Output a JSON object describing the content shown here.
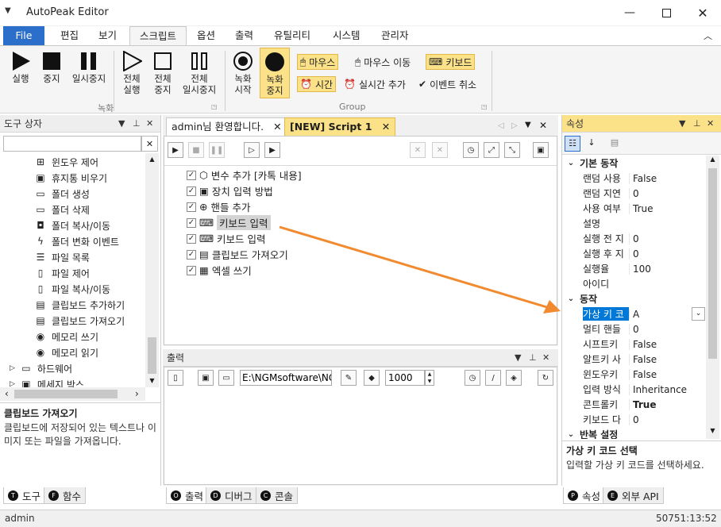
{
  "window": {
    "title": "AutoPeak Editor"
  },
  "ribbon_tabs": [
    "File",
    "편집",
    "보기",
    "스크립트",
    "옵션",
    "출력",
    "유틸리티",
    "시스템",
    "관리자"
  ],
  "ribbon": {
    "record_group": {
      "label": "녹화",
      "buttons": [
        {
          "line1": "실행",
          "line2": ""
        },
        {
          "line1": "중지",
          "line2": ""
        },
        {
          "line1": "일시중지",
          "line2": ""
        },
        {
          "line1": "전체",
          "line2": "실행"
        },
        {
          "line1": "전체",
          "line2": "중지"
        },
        {
          "line1": "전체",
          "line2": "일시중지"
        }
      ]
    },
    "group2": {
      "label": "Group",
      "record_start": {
        "line1": "녹화",
        "line2": "시작"
      },
      "record_stop": {
        "line1": "녹화",
        "line2": "중지"
      },
      "mouse": "마우스",
      "mouse_move": "마우스 이동",
      "keyboard": "키보드",
      "time": "시간",
      "realtime_add": "실시간 추가",
      "event_cancel": "이벤트 취소"
    }
  },
  "toolbox": {
    "title": "도구 상자",
    "search_placeholder": "",
    "items": [
      {
        "label": "윈도우 제어",
        "icon": "windows-icon"
      },
      {
        "label": "휴지통 비우기",
        "icon": "trash-icon"
      },
      {
        "label": "폴더 생성",
        "icon": "folder-icon"
      },
      {
        "label": "폴더 삭제",
        "icon": "folder-icon"
      },
      {
        "label": "폴더 복사/이동",
        "icon": "folder-copy-icon"
      },
      {
        "label": "폴더 변화 이벤트",
        "icon": "lightning-icon"
      },
      {
        "label": "파일 목록",
        "icon": "list-icon"
      },
      {
        "label": "파일 제어",
        "icon": "file-icon"
      },
      {
        "label": "파일 복사/이동",
        "icon": "file-copy-icon"
      },
      {
        "label": "클립보드 추가하기",
        "icon": "clipboard-icon"
      },
      {
        "label": "클립보드 가져오기",
        "icon": "clipboard-icon"
      },
      {
        "label": "메모리 쓰기",
        "icon": "memory-icon"
      },
      {
        "label": "메모리 읽기",
        "icon": "memory-icon"
      }
    ],
    "roots": [
      {
        "label": "하드웨어"
      },
      {
        "label": "메세지 박스"
      }
    ],
    "desc_title": "클립보드 가져오기",
    "desc_text": "클립보드에 저장되어 있는 텍스트나 이미지 또는 파일을 가져옵니다.",
    "tabs": [
      {
        "letter": "T",
        "label": "도구"
      },
      {
        "letter": "F",
        "label": "함수"
      }
    ]
  },
  "document": {
    "tabs": [
      {
        "label": "admin님 환영합니다."
      },
      {
        "label": "[NEW] Script 1"
      }
    ],
    "script_lines": [
      "변수 추가 [카톡 내용]",
      "장치 입력 방법",
      "핸들 추가",
      "키보드 입력",
      "키보드 입력",
      "클립보드 가져오기",
      "엑셀 쓰기"
    ]
  },
  "output": {
    "title": "출력",
    "path_value": "E:\\NGMsoftware\\NG",
    "count_value": "1000",
    "tabs": [
      {
        "letter": "O",
        "label": "출력"
      },
      {
        "letter": "D",
        "label": "디버그"
      },
      {
        "letter": "C",
        "label": "콘솔"
      }
    ]
  },
  "properties": {
    "title": "속성",
    "cat_basic": "기본 동작",
    "basic_rows": [
      {
        "key": "랜덤 사용",
        "value": "False"
      },
      {
        "key": "랜덤 지연",
        "value": "0"
      },
      {
        "key": "사용 여부",
        "value": "True"
      },
      {
        "key": "설명",
        "value": ""
      },
      {
        "key": "실행 전 지",
        "value": "0"
      },
      {
        "key": "실행 후 지",
        "value": "0"
      },
      {
        "key": "실행율",
        "value": "100"
      },
      {
        "key": "아이디",
        "value": ""
      }
    ],
    "cat_action": "동작",
    "action_rows": [
      {
        "key": "가상 키 코",
        "value": "A"
      },
      {
        "key": "멀티 핸들",
        "value": "0"
      },
      {
        "key": "시프트키 ",
        "value": "False"
      },
      {
        "key": "알트키 사",
        "value": "False"
      },
      {
        "key": "윈도우키 ",
        "value": "False"
      },
      {
        "key": "입력 방식",
        "value": "Inheritance"
      },
      {
        "key": "콘트롤키 ",
        "value": "True"
      },
      {
        "key": "키보드 다",
        "value": "0"
      }
    ],
    "cat_repeat": "반복 설정",
    "desc_title": "가상 키 코드 선택",
    "desc_text": "입력할 가상 키 코드를 선택하세요.",
    "tabs": [
      {
        "letter": "P",
        "label": "속성"
      },
      {
        "letter": "E",
        "label": "외부 API"
      }
    ]
  },
  "status": {
    "user": "admin",
    "clock": "50751:13:52"
  },
  "colors": {
    "accent": "#2b6fca",
    "highlight": "#fbe289",
    "arrow": "#f28a30",
    "selection": "#0078d7"
  }
}
